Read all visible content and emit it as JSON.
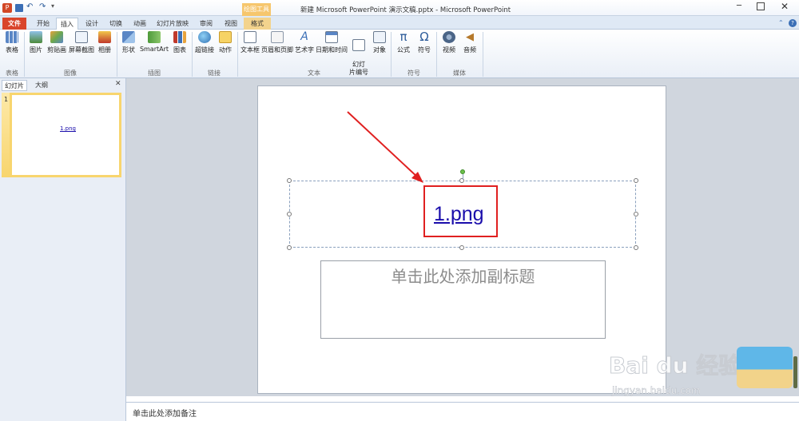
{
  "titlebar": {
    "title": "新建 Microsoft PowerPoint 演示文稿.pptx - Microsoft PowerPoint",
    "contextual_group": "绘图工具"
  },
  "tabs": [
    "文件",
    "开始",
    "插入",
    "设计",
    "切换",
    "动画",
    "幻灯片放映",
    "审阅",
    "视图",
    "格式"
  ],
  "ribbon": {
    "groups": [
      {
        "label": "表格",
        "buttons": [
          "表格"
        ]
      },
      {
        "label": "图像",
        "buttons": [
          "图片",
          "剪贴画",
          "屏幕截图",
          "相册"
        ]
      },
      {
        "label": "插图",
        "buttons": [
          "形状",
          "SmartArt",
          "图表"
        ]
      },
      {
        "label": "链接",
        "buttons": [
          "超链接",
          "动作"
        ]
      },
      {
        "label": "文本",
        "buttons": [
          "文本框",
          "页眉和页脚",
          "艺术字",
          "日期和时间",
          "幻灯\n片编号",
          "对象"
        ]
      },
      {
        "label": "符号",
        "buttons": [
          "公式",
          "符号"
        ]
      },
      {
        "label": "媒体",
        "buttons": [
          "视频",
          "音频"
        ]
      }
    ]
  },
  "leftpane": {
    "tabs": [
      "幻灯片",
      "大纲"
    ],
    "close": "✕",
    "thumb_number": "1",
    "thumb_link": "1.png"
  },
  "slide": {
    "title_link": "1.png",
    "subtitle_placeholder": "单击此处添加副标题"
  },
  "notes": {
    "placeholder": "单击此处添加备注"
  },
  "watermark": {
    "brand": "Bai du 经验",
    "url": "jingyan.baidu.com"
  },
  "colors": {
    "file_tab": "#d9452b",
    "annotation": "#e02020",
    "link": "#1a0dab"
  }
}
